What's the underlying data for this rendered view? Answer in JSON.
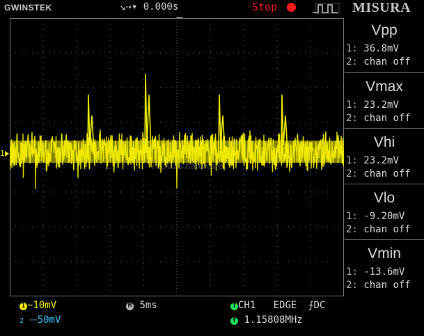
{
  "header": {
    "brand": "GWINSTEK",
    "trigger_position": "0.000s",
    "run_state": "Stop",
    "watermark_brand": "MISURA"
  },
  "grid": {
    "channel_marker": "1",
    "center_watermark": "HEXUS.hardware"
  },
  "measurements": [
    {
      "title": "Vpp",
      "line1_label": "1:",
      "line1_value": "36.8mV",
      "line2_label": "2:",
      "line2_value": "chan off"
    },
    {
      "title": "Vmax",
      "line1_label": "1:",
      "line1_value": "23.2mV",
      "line2_label": "2:",
      "line2_value": "chan off"
    },
    {
      "title": "Vhi",
      "line1_label": "1:",
      "line1_value": "23.2mV",
      "line2_label": "2:",
      "line2_value": "chan off"
    },
    {
      "title": "Vlo",
      "line1_label": "1:",
      "line1_value": "-9.20mV",
      "line2_label": "2:",
      "line2_value": "chan off"
    },
    {
      "title": "Vmin",
      "line1_label": "1:",
      "line1_value": "-13.6mV",
      "line2_label": "2:",
      "line2_value": "chan off"
    }
  ],
  "footer": {
    "ch1_badge": "1",
    "ch1_coupling_icon": "ac-coupling-icon",
    "ch1_scale": "10mV",
    "ch2_badge": "2",
    "ch2_coupling_icon": "dc-coupling-icon",
    "ch2_scale": "50mV",
    "timebase_badge": "M",
    "timebase": "5ms",
    "trigger_badge": "T",
    "trigger_source": "CH1",
    "trigger_type": "EDGE",
    "trigger_coupling_icon": "rising-edge-icon",
    "trigger_coupling": "DC",
    "freq_badge": "f",
    "frequency": "1.15808MHz"
  },
  "colors": {
    "ch1": "#f2ef00",
    "ch2": "#3ec6ff",
    "stop": "#ff1a1a",
    "grid": "#7a7a7a",
    "trigger": "#22e05a"
  }
}
